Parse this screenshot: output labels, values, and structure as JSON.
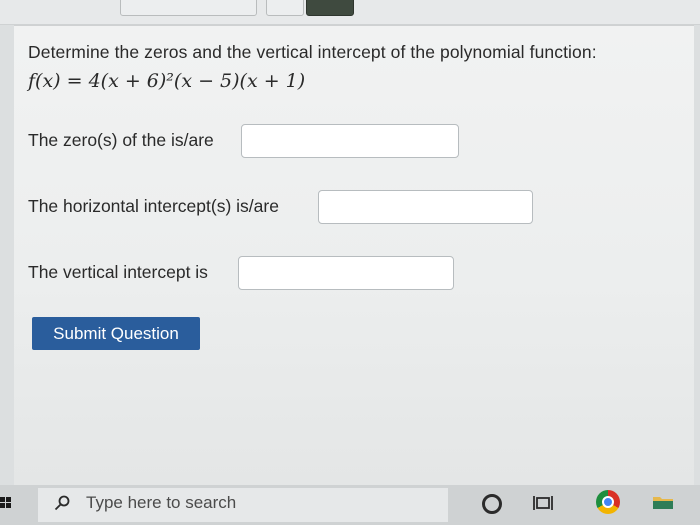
{
  "question": {
    "prompt": "Determine the zeros and the vertical intercept of the polynomial function:",
    "formula": "f(x) = 4(x + 6)²(x − 5)(x + 1)"
  },
  "answers": [
    {
      "label": "The zero(s) of the is/are",
      "value": ""
    },
    {
      "label": "The horizontal intercept(s) is/are",
      "value": ""
    },
    {
      "label": "The vertical intercept is",
      "value": ""
    }
  ],
  "submit_label": "Submit Question",
  "taskbar": {
    "search_placeholder": "Type here to search",
    "icons": [
      "windows-start-icon",
      "search-icon",
      "cortana-icon",
      "task-view-icon",
      "chrome-icon",
      "file-explorer-icon"
    ]
  }
}
